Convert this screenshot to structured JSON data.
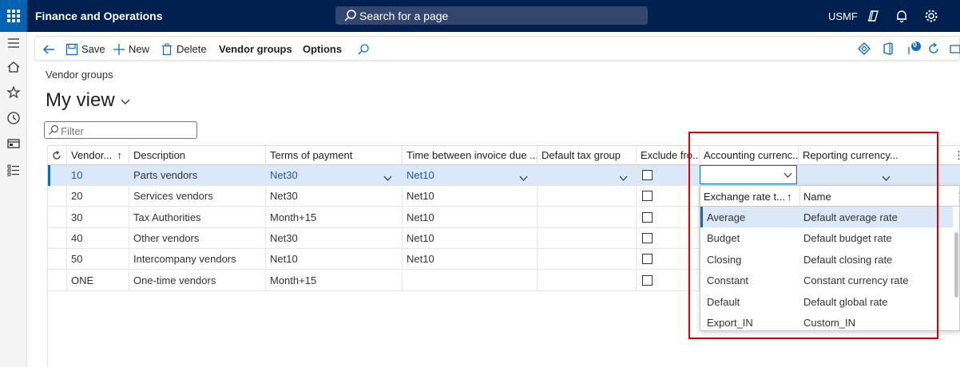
{
  "app": {
    "title": "Finance and Operations",
    "search_placeholder": "Search for a page",
    "company": "USMF"
  },
  "toolbar": {
    "save": "Save",
    "new": "New",
    "delete": "Delete",
    "vendor_groups": "Vendor groups",
    "options": "Options",
    "notification_count": "0"
  },
  "page": {
    "breadcrumb": "Vendor groups",
    "view_title": "My view",
    "filter_placeholder": "Filter"
  },
  "grid": {
    "columns": [
      "Vendor...",
      "Description",
      "Terms of payment",
      "Time between invoice due ...",
      "Default tax group",
      "Exclude fro...",
      "Accounting currenc...",
      "Reporting currency..."
    ],
    "rows": [
      {
        "group": "10",
        "description": "Parts vendors",
        "terms": "Net30",
        "time": "Net10",
        "tax": "",
        "selected": true
      },
      {
        "group": "20",
        "description": "Services vendors",
        "terms": "Net30",
        "time": "Net10",
        "tax": ""
      },
      {
        "group": "30",
        "description": "Tax Authorities",
        "terms": "Month+15",
        "time": "Net10",
        "tax": ""
      },
      {
        "group": "40",
        "description": "Other vendors",
        "terms": "Net30",
        "time": "Net10",
        "tax": ""
      },
      {
        "group": "50",
        "description": "Intercompany vendors",
        "terms": "Net10",
        "time": "Net10",
        "tax": ""
      },
      {
        "group": "ONE",
        "description": "One-time vendors",
        "terms": "Month+15",
        "time": "",
        "tax": ""
      }
    ]
  },
  "lookup": {
    "columns": [
      "Exchange rate t...",
      "Name"
    ],
    "rows": [
      {
        "type": "Average",
        "name": "Default average rate",
        "selected": true
      },
      {
        "type": "Budget",
        "name": "Default budget rate"
      },
      {
        "type": "Closing",
        "name": "Default closing rate"
      },
      {
        "type": "Constant",
        "name": "Constant currency rate"
      },
      {
        "type": "Default",
        "name": "Default global rate"
      },
      {
        "type": "Export_IN",
        "name": "Custom_IN"
      }
    ]
  },
  "colors": {
    "topbar": "#002050",
    "accent": "#0f6cbd",
    "selection": "#dbe8fa",
    "highlight_box": "#e00000"
  }
}
